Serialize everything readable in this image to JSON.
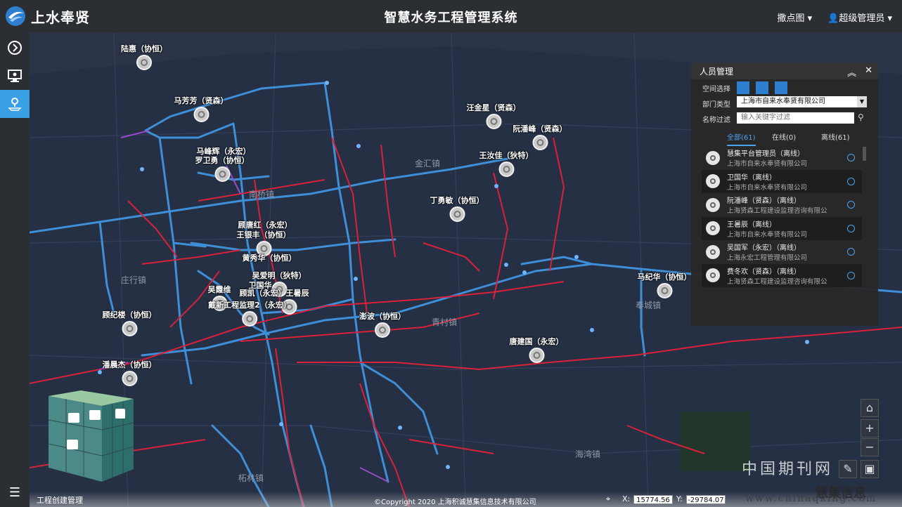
{
  "header": {
    "logo_text": "上水奉贤",
    "title": "智慧水务工程管理系统",
    "map_menu": "撒点图 ▾",
    "user_menu": "超级管理员 ▾"
  },
  "leftbar": {
    "icons": [
      "play-circle-icon",
      "monitor-icon",
      "location-user-icon"
    ],
    "menu_icon": "☰"
  },
  "map": {
    "places": [
      "南桥镇",
      "金汇镇",
      "庄行镇",
      "青村镇",
      "海湾镇",
      "柘林镇",
      "奉城镇"
    ],
    "markers": [
      {
        "label": "陆惠（协恒）"
      },
      {
        "label": "马芳芳（贤森）"
      },
      {
        "label": "马峰辉（永宏）"
      },
      {
        "label": "罗卫勇（协恒）"
      },
      {
        "label": "汪金星（贤森）"
      },
      {
        "label": "阮潘峰（贤森）"
      },
      {
        "label": "王汝佳（狄特）"
      },
      {
        "label": "丁勇敏（协恒）"
      },
      {
        "label": "顾唐红（永宏）"
      },
      {
        "label": "王银丰（协恒）"
      },
      {
        "label": "黄秀华（协恒）"
      },
      {
        "label": "吴爱明（狄特）"
      },
      {
        "label": "卫国华"
      },
      {
        "label": "吴霞维"
      },
      {
        "label": "顾凯（永宏）王暑辰"
      },
      {
        "label": "戴新工程监理2（永宏）"
      },
      {
        "label": "澎波（协恒）"
      },
      {
        "label": "马纪华（协恒）"
      },
      {
        "label": "顾纪楼（协恒）"
      },
      {
        "label": "唐建国（永宏）"
      },
      {
        "label": "潘晨杰（协恒）"
      }
    ]
  },
  "panel": {
    "title": "人员管理",
    "space_label": "空间选择",
    "dept_label": "部门类型",
    "dept_value": "上海市自来水奉贤有限公司",
    "name_label": "名称过滤",
    "name_placeholder": "输入关键字过滤",
    "tabs": [
      "全部(61)",
      "在线(0)",
      "离线(61)"
    ],
    "people": [
      {
        "name": "慧集平台管理员",
        "status": "（离线）",
        "company": "上海市自来水奉贤有限公司"
      },
      {
        "name": "卫国华",
        "status": "（离线）",
        "company": "上海市自来水奉贤有限公司"
      },
      {
        "name": "阮潘峰（贤森）",
        "status": "（离线）",
        "company": "上海贤森工程建设监理咨询有限公"
      },
      {
        "name": "王暑辰",
        "status": "（离线）",
        "company": "上海市自来水奉贤有限公司"
      },
      {
        "name": "吴国军（永宏）",
        "status": "（离线）",
        "company": "上海永宏工程管理有限公司"
      },
      {
        "name": "费冬欢（贤森）",
        "status": "（离线）",
        "company": "上海贤森工程建设监理咨询有限公"
      }
    ]
  },
  "bottom": {
    "label": "工程创建管理",
    "copyright": "©Copyright 2020 上海积诚慧集信息技术有限公司",
    "x_label": "X:",
    "x_value": "15774.56",
    "y_label": "Y:",
    "y_value": "-29784.07"
  },
  "watermark": {
    "cn": "中国期刊网",
    "url": "www.chinaqking.com",
    "brand": "慧集信息"
  },
  "colors": {
    "accent": "#3aa0e4",
    "pipe_blue": "#3f8fd8",
    "pipe_red": "#d9213a",
    "pipe_purple": "#9b47c9",
    "topbar": "#2b2e33"
  }
}
